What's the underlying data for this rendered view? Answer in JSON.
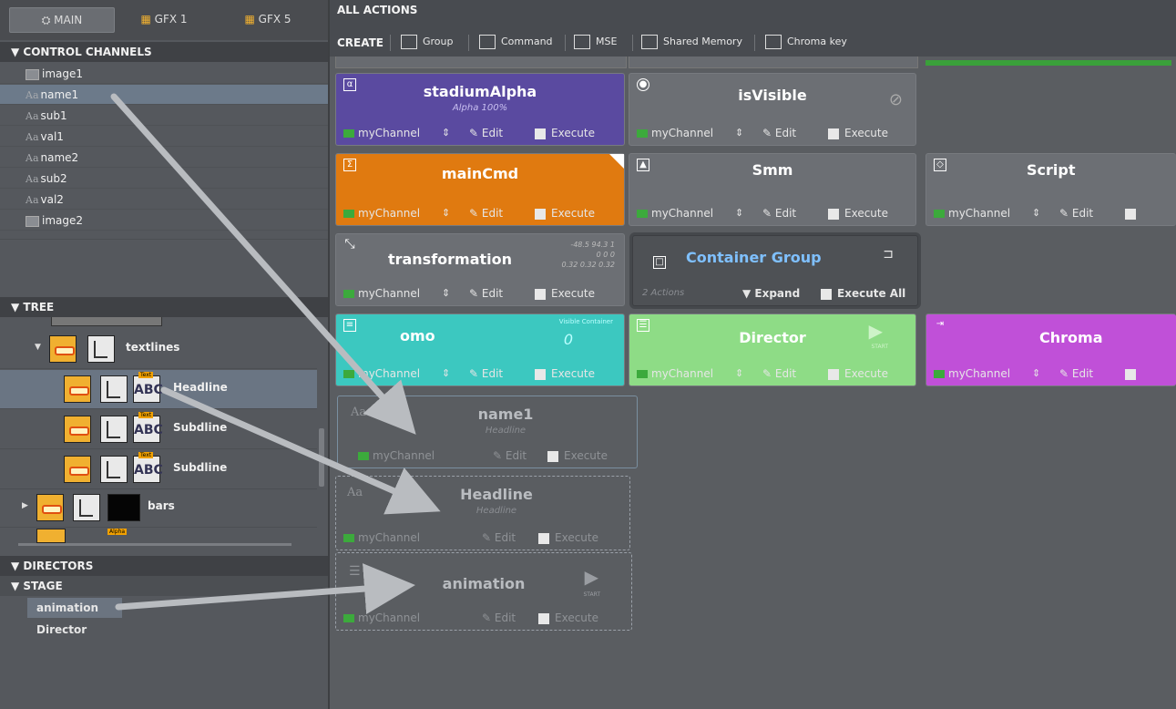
{
  "tabs": {
    "main": "MAIN",
    "gfx1": "GFX 1",
    "gfx5": "GFX 5"
  },
  "control_channels": {
    "header": "▼ CONTROL CHANNELS",
    "items": [
      {
        "label": "image1",
        "kind": "image"
      },
      {
        "label": "name1",
        "kind": "text",
        "selected": true
      },
      {
        "label": "sub1",
        "kind": "text"
      },
      {
        "label": "val1",
        "kind": "text"
      },
      {
        "label": "name2",
        "kind": "text"
      },
      {
        "label": "sub2",
        "kind": "text"
      },
      {
        "label": "val2",
        "kind": "text"
      },
      {
        "label": "image2",
        "kind": "image"
      }
    ]
  },
  "tree": {
    "header": "▼ TREE",
    "rows": [
      {
        "label": "textlines"
      },
      {
        "label": "Headline",
        "selected": true
      },
      {
        "label": "Subdline"
      },
      {
        "label": "Subdline"
      },
      {
        "label": "bars"
      }
    ],
    "icon_text_badge": "Text",
    "icon_abc": "ABC",
    "icon_alpha_badge": "Alpha"
  },
  "directors": {
    "header": "▼ DIRECTORS",
    "stage": "▼ STAGE",
    "items": [
      "animation",
      "Director"
    ]
  },
  "actions": {
    "title": "ALL ACTIONS",
    "create_label": "CREATE",
    "create_buttons": [
      "Group",
      "Command",
      "MSE",
      "Shared Memory",
      "Chroma key"
    ],
    "common": {
      "channel": "myChannel",
      "edit": "Edit",
      "execute": "Execute"
    },
    "cards": {
      "stadiumAlpha": {
        "title": "stadiumAlpha",
        "sub": "Alpha 100%",
        "icon": "α"
      },
      "isVisible": {
        "title": "isVisible"
      },
      "mainCmd": {
        "title": "mainCmd"
      },
      "smm": {
        "title": "Smm"
      },
      "script": {
        "title": "Script"
      },
      "transformation": {
        "title": "transformation",
        "vals": [
          "-48.5 94.3 1",
          "0 0 0",
          "0.32 0.32 0.32"
        ]
      },
      "container": {
        "title": "Container Group",
        "count": "2 Actions",
        "expand": "▼ Expand",
        "execute_all": "Execute All"
      },
      "omo": {
        "title": "omo",
        "sub": "Visible Container",
        "value": "0"
      },
      "director": {
        "title": "Director",
        "start": "START"
      },
      "chroma": {
        "title": "Chroma"
      },
      "ghost_name1": {
        "title": "name1",
        "sub": "Headline"
      },
      "ghost_headline": {
        "title": "Headline",
        "sub": "Headline"
      },
      "ghost_animation": {
        "title": "animation",
        "start": "START"
      }
    }
  }
}
